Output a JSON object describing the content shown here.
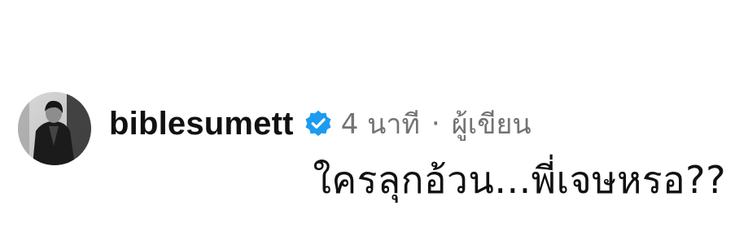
{
  "comment": {
    "username": "biblesumett",
    "time": "4 นาที",
    "separator": "·",
    "role": "ผู้เขียน",
    "text": "ใครลุกอ้วน...พี่เจษหรอ??"
  },
  "icons": {
    "verified": "verified-badge-icon",
    "avatar": "profile-avatar"
  },
  "colors": {
    "verified": "#1d9bf0",
    "meta_text": "#737373",
    "text": "#111111"
  }
}
